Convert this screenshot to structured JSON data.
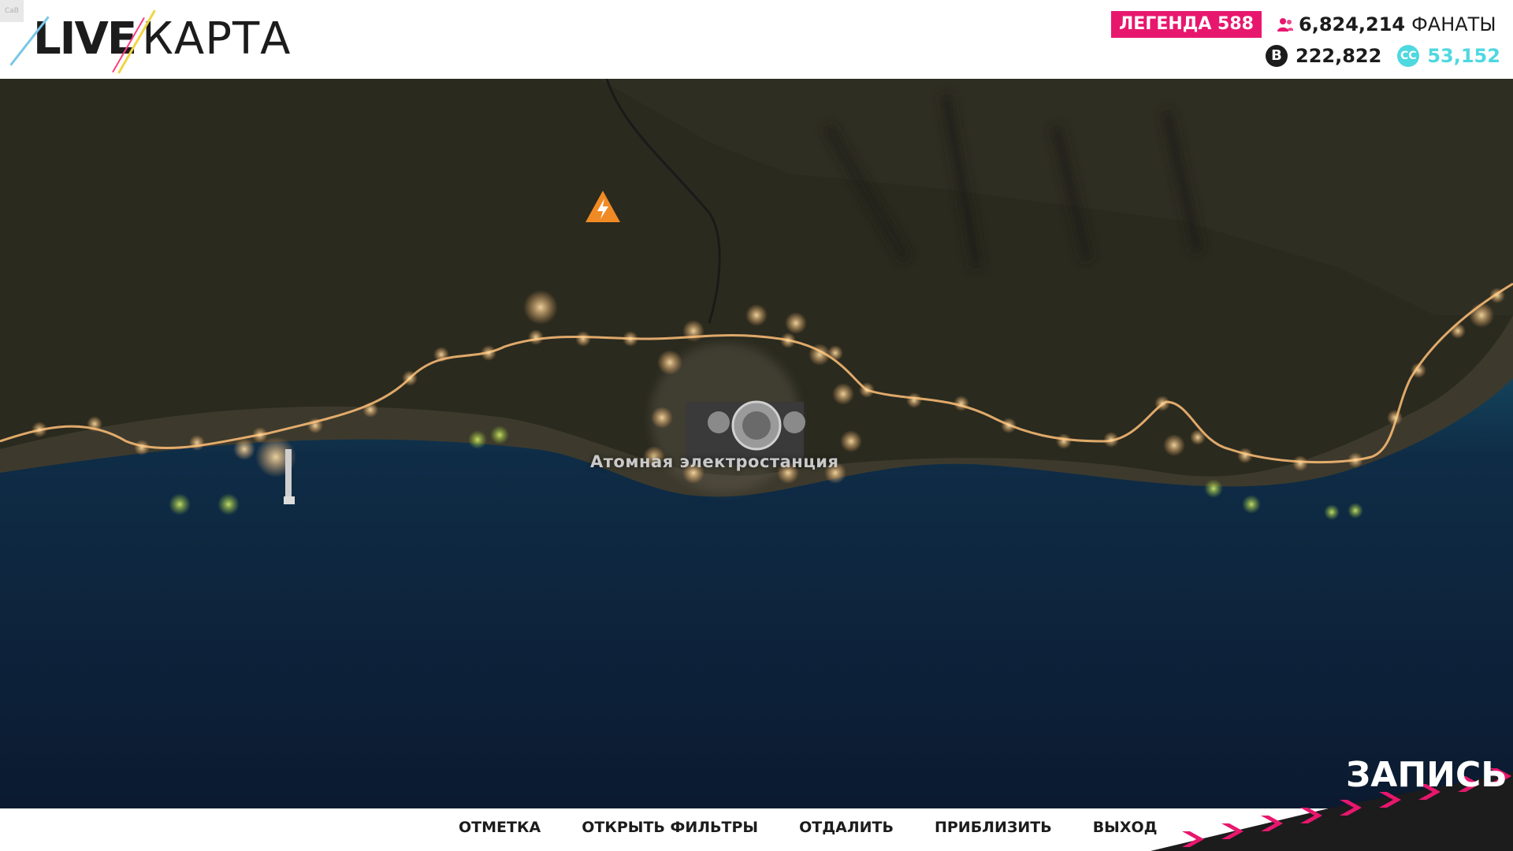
{
  "header": {
    "corner_tag": "CaB",
    "logo_live": "LIVE",
    "logo_map": "КАРТА",
    "legend_label": "ЛЕГЕНДА 588",
    "fans_count": "6,824,214",
    "fans_label": "ФАНАТЫ",
    "credits": "222,822",
    "credits_icon": "B",
    "skill_points": "53,152",
    "skill_icon": "CC"
  },
  "map": {
    "location_label": "Атомная электростанция",
    "marker_icon": "power-station-icon"
  },
  "menu": {
    "items": [
      "ОТМЕТКА",
      "ОТКРЫТЬ ФИЛЬТРЫ",
      "ОТДАЛИТЬ",
      "ПРИБЛИЗИТЬ",
      "ВЫХОД"
    ]
  },
  "record": {
    "label": "ЗАПИСЬ"
  },
  "colors": {
    "accent_pink": "#e8176e",
    "accent_cyan": "#4fd8e0",
    "terrain": "#2b2a20",
    "sea": "#0f2238",
    "road_light": "#ffd18a"
  }
}
